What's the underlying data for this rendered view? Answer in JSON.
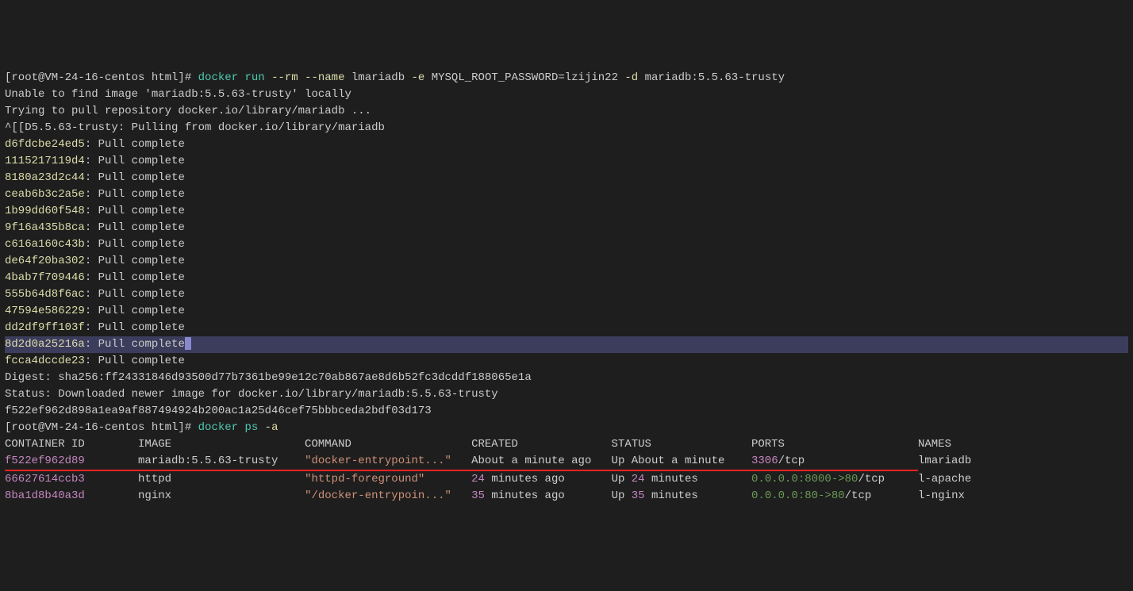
{
  "prompt1": {
    "user_host": "[root@VM-24-16-centos html]# ",
    "cmd": "docker run",
    "flag_rm": "--rm",
    "flag_name": "--name",
    "name_val": " lmariadb ",
    "flag_e": "-e",
    "env_val": " MYSQL_ROOT_PASSWORD=lzijin22 ",
    "flag_d": "-d",
    "image": " mariadb:5.5.63-trusty"
  },
  "pull_output": {
    "line1": "Unable to find image 'mariadb:5.5.63-trusty' locally",
    "line2": "Trying to pull repository docker.io/library/mariadb ...",
    "line3": "^[[D5.5.63-trusty: Pulling from docker.io/library/mariadb",
    "layers": [
      {
        "id": "d6fdcbe24ed5",
        "status": ": Pull complete"
      },
      {
        "id": "1115217119d4",
        "status": ": Pull complete"
      },
      {
        "id": "8180a23d2c44",
        "status": ": Pull complete"
      },
      {
        "id": "ceab6b3c2a5e",
        "status": ": Pull complete"
      },
      {
        "id": "1b99dd60f548",
        "status": ": Pull complete"
      },
      {
        "id": "9f16a435b8ca",
        "status": ": Pull complete"
      },
      {
        "id": "c616a160c43b",
        "status": ": Pull complete"
      },
      {
        "id": "de64f20ba302",
        "status": ": Pull complete"
      },
      {
        "id": "4bab7f709446",
        "status": ": Pull complete"
      },
      {
        "id": "555b64d8f6ac",
        "status": ": Pull complete"
      },
      {
        "id": "47594e586229",
        "status": ": Pull complete"
      },
      {
        "id": "dd2df9ff103f",
        "status": ": Pull complete"
      },
      {
        "id": "8d2d0a25216a",
        "status": ": Pull complete"
      },
      {
        "id": "fcca4dccde23",
        "status": ": Pull complete"
      }
    ],
    "digest_label": "Digest: ",
    "digest": "sha256:ff24331846d93500d77b7361be99e12c70ab867ae8d6b52fc3dcddf188065e1a",
    "status_line": "Status: Downloaded newer image for docker.io/library/mariadb:5.5.63-trusty",
    "container_id": "f522ef962d898a1ea9af887494924b200ac1a25d46cef75bbbceda2bdf03d173"
  },
  "prompt2": {
    "user_host": "[root@VM-24-16-centos html]# ",
    "cmd": "docker ps",
    "flag_a": "-a"
  },
  "table": {
    "headers": {
      "container_id": "CONTAINER ID",
      "image": "IMAGE",
      "command": "COMMAND",
      "created": "CREATED",
      "status": "STATUS",
      "ports": "PORTS",
      "names": "NAMES"
    },
    "rows": [
      {
        "container_id": "f522ef962d89",
        "image": "mariadb:5.5.63-trusty",
        "command": "\"docker-entrypoint...\"",
        "created": "About a minute ago",
        "status_prefix": "Up ",
        "status_time": "About a minute",
        "ports_num": "3306",
        "ports_suffix": "/tcp",
        "names": "lmariadb"
      },
      {
        "container_id": "66627614ccb3",
        "image": "httpd",
        "command": "\"httpd-foreground\"",
        "created_num": "24",
        "created_suffix": " minutes ago",
        "status_prefix": "Up ",
        "status_num": "24",
        "status_suffix": " minutes",
        "ports_ip": "0.0.0.0:8000->80",
        "ports_suffix": "/tcp",
        "names": "l-apache"
      },
      {
        "container_id": "8ba1d8b40a3d",
        "image": "nginx",
        "command": "\"/docker-entrypoin...\"",
        "created_num": "35",
        "created_suffix": " minutes ago",
        "status_prefix": "Up ",
        "status_num": "35",
        "status_suffix": " minutes",
        "ports_ip": "0.0.0.0:80->80",
        "ports_suffix": "/tcp",
        "names": "l-nginx"
      }
    ]
  }
}
